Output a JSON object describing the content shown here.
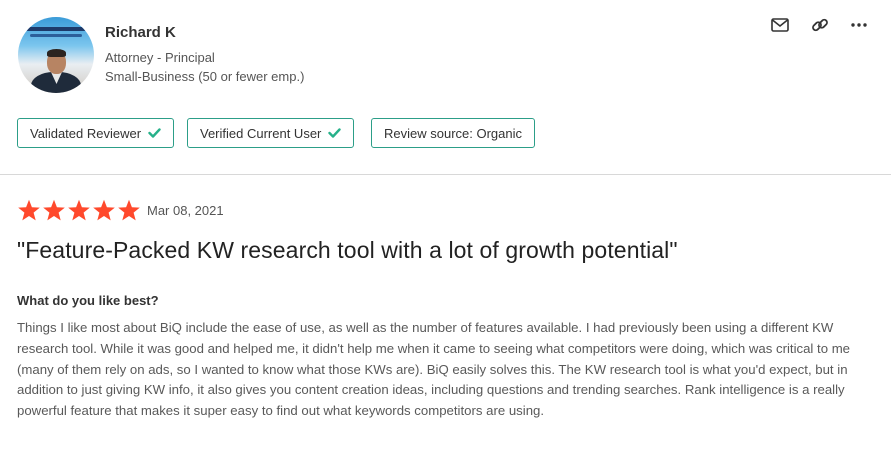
{
  "reviewer": {
    "name": "Richard K",
    "title": "Attorney - Principal",
    "company_size": "Small-Business (50 or fewer emp.)",
    "avatar_icon": "reviewer-avatar"
  },
  "actions": {
    "message_icon": "envelope-icon",
    "link_icon": "link-icon",
    "more_icon": "ellipsis-icon"
  },
  "badges": [
    {
      "label": "Validated Reviewer",
      "check": true
    },
    {
      "label": "Verified Current User",
      "check": true
    },
    {
      "label": "Review source: Organic",
      "check": false
    }
  ],
  "review": {
    "rating": 5,
    "max_rating": 5,
    "date": "Mar 08, 2021",
    "title": "\"Feature-Packed KW research tool with a lot of growth potential\"",
    "question": "What do you like best?",
    "answer": "Things I like most about BiQ include the ease of use, as well as the number of features available. I had previously been using a different KW research tool. While it was good and helped me, it didn't help me when it came to seeing what competitors were doing, which was critical to me (many of them rely on ads, so I wanted to know what those KWs are). BiQ easily solves this. The KW research tool is what you'd expect, but in addition to just giving KW info, it also gives you content creation ideas, including questions and trending searches. Rank intelligence is a really powerful feature that makes it super easy to find out what keywords competitors are using."
  },
  "colors": {
    "star": "#ff492c",
    "badge_border": "#2c9e88",
    "check": "#27b18a"
  }
}
